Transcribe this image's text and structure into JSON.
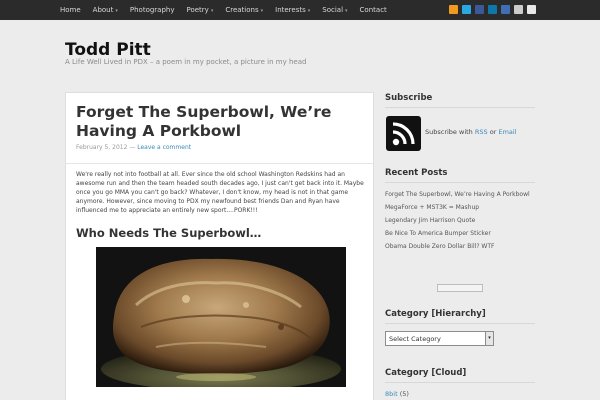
{
  "nav": {
    "items": [
      {
        "label": "Home",
        "dropdown": false
      },
      {
        "label": "About",
        "dropdown": true
      },
      {
        "label": "Photography",
        "dropdown": false
      },
      {
        "label": "Poetry",
        "dropdown": true
      },
      {
        "label": "Creations",
        "dropdown": true
      },
      {
        "label": "Interests",
        "dropdown": true
      },
      {
        "label": "Social",
        "dropdown": true
      },
      {
        "label": "Contact",
        "dropdown": false
      }
    ],
    "caret": "▾",
    "social_icons": [
      {
        "name": "rss-icon",
        "color": "#f09a1f"
      },
      {
        "name": "twitter-icon",
        "color": "#2aa9e0"
      },
      {
        "name": "facebook-icon",
        "color": "#3b5998"
      },
      {
        "name": "linkedin-icon",
        "color": "#0e76a8"
      },
      {
        "name": "flickr-icon",
        "color": "#3f6fb6"
      },
      {
        "name": "google-plus-icon",
        "color": "#cccccc"
      },
      {
        "name": "email-icon",
        "color": "#e8e8e8"
      }
    ]
  },
  "site": {
    "title": "Todd Pitt",
    "tagline": "A Life Well Lived in PDX – a poem in my pocket, a picture in my head"
  },
  "post": {
    "title": "Forget The Superbowl, We’re Having A Porkbowl",
    "date": "February 5, 2012",
    "meta_sep": "—",
    "comment_link": "Leave a comment",
    "body": "We're really not into football at all.  Ever since the old school Washington Redskins had an awesome run and then the team headed south decades ago, I just can't get back into it. Maybe once you go MMA you can't go back?  Whatever, I don't know, my head is not in that game anymore.  However, since moving to PDX my newfound best friends Dan and Ryan have influenced me to appreciate an entirely new sport....PORK!!!",
    "subheading": "Who Needs The Superbowl…"
  },
  "sidebar": {
    "subscribe_heading": "Subscribe",
    "subscribe_prefix": "Subscribe with",
    "subscribe_rss": "RSS",
    "subscribe_or": "or",
    "subscribe_email": "Email",
    "recent_heading": "Recent Posts",
    "recent_posts": [
      "Forget The Superbowl, We’re Having A Porkbowl",
      "MegaForce + MST3K = Mashup",
      "Legendary Jim Harrison Quote",
      "Be Nice To America Bumper Sticker",
      "Obama Double Zero Dollar Bill? WTF"
    ],
    "category_hier_heading": "Category [Hierarchy]",
    "category_select": "Select Category",
    "category_cloud_heading": "Category [Cloud]",
    "cloud_first_tag": "8bit",
    "cloud_first_count": "(5)"
  }
}
